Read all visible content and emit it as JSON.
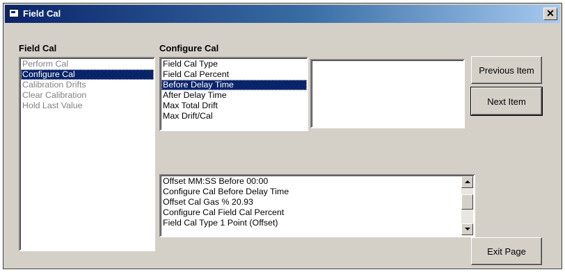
{
  "window": {
    "title": "Field Cal",
    "close_glyph": "✕",
    "title_icon": "window-icon"
  },
  "field_cal": {
    "label": "Field Cal",
    "items": [
      "Perform Cal",
      "Configure Cal",
      "Calibration Drifts",
      "Clear Calibration",
      "Hold Last Value"
    ],
    "selected_index": 1
  },
  "configure_cal": {
    "label": "Configure Cal",
    "items": [
      "Field Cal Type",
      "Field Cal Percent",
      "Before Delay Time",
      "After Delay Time",
      "Max  Total Drift",
      "Max Drift/Cal"
    ],
    "selected_index": 2
  },
  "log": {
    "lines": [
      "Offset MM:SS Before  00:00",
      "Configure Cal  Before Delay Time",
      "Offset Cal Gas %  20.93",
      "Configure Cal  Field Cal Percent",
      "Field Cal Type   1 Point (Offset)"
    ]
  },
  "buttons": {
    "previous": "Previous Item",
    "next": "Next Item",
    "exit": "Exit Page"
  },
  "colors": {
    "selection": "#0a246a",
    "face": "#d4d0c8",
    "disabled_text": "#808080"
  }
}
